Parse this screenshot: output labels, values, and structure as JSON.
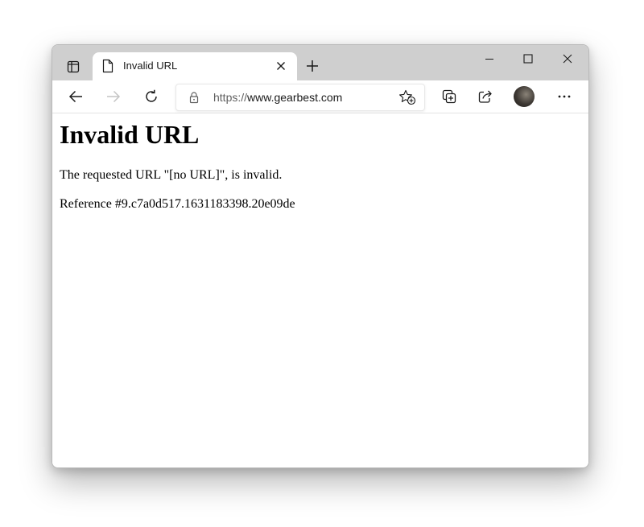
{
  "browser": {
    "tab": {
      "title": "Invalid URL"
    },
    "address_bar": {
      "protocol": "https://",
      "host": "www.gearbest.com"
    },
    "icons": {
      "tab_actions": "tab-actions-icon",
      "favicon": "page-icon",
      "tab_close": "close-icon",
      "new_tab": "plus-icon",
      "minimize": "minimize-icon",
      "maximize": "maximize-icon",
      "close_window": "close-icon",
      "back": "arrow-left-icon",
      "forward": "arrow-right-icon",
      "refresh": "refresh-icon",
      "lock": "lock-icon",
      "favorite": "star-add-icon",
      "collections": "collections-icon",
      "share": "share-icon",
      "profile": "avatar",
      "menu": "more-icon"
    },
    "colors": {
      "titlebar": "#cfcfcf",
      "forward_disabled": "#c4c4c4"
    }
  },
  "page": {
    "heading": "Invalid URL",
    "message": "The requested URL \"[no URL]\", is invalid.",
    "reference": "Reference #9.c7a0d517.1631183398.20e09de"
  }
}
